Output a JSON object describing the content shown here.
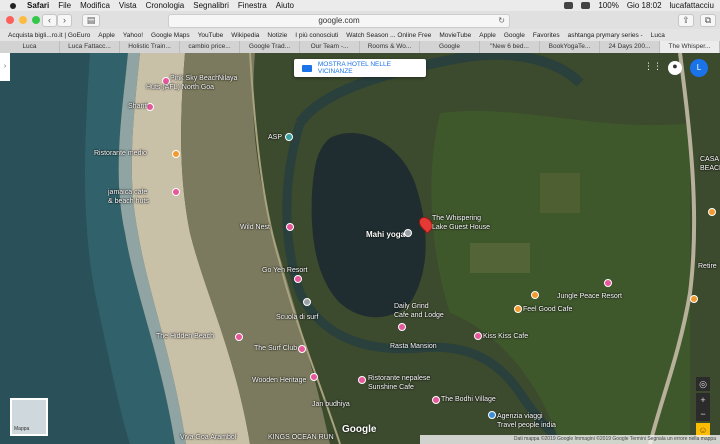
{
  "menubar": {
    "app": "Safari",
    "items": [
      "File",
      "Modifica",
      "Vista",
      "Cronologia",
      "Segnalibri",
      "Finestra",
      "Aiuto"
    ],
    "battery": "100%",
    "clock": "Gio 18:02",
    "user": "lucafattacciu"
  },
  "toolbar": {
    "url": "google.com"
  },
  "bookmarks": [
    "Acquista bigli...ro.it | GoEuro",
    "Apple",
    "Yahoo!",
    "Google Maps",
    "YouTube",
    "Wikipedia",
    "Notizie",
    "I più conosciuti",
    "Watch Season ... Online Free",
    "MovieTube",
    "Apple",
    "Google",
    "Favorites",
    "ashtanga prymary series -",
    "Luca"
  ],
  "tabs": [
    "Luca",
    "Luca Fattacc...",
    "Holistic Train...",
    "cambio price...",
    "Google Trad...",
    "Our Team -...",
    "Rooms & Wo...",
    "Google",
    "\"New 6 bed...",
    "BookYogaTe...",
    "24 Days 200...",
    "The Whisper..."
  ],
  "map": {
    "hotel_button": "MOSTRA HOTEL NELLE VICINANZE",
    "labels": {
      "l1": "Pink Sky Beach",
      "l2": "Huts (AFL) North Goa",
      "l3": "Shanti",
      "l4": "Nilaya",
      "l5": "ASP",
      "l6": "Ristorante medio",
      "l7": "jamaica cafe",
      "l8": "& beach huts",
      "l9": "Wild Nest",
      "l10": "Mahi yoga",
      "l11": "The Whispering",
      "l12": "Lake Guest House",
      "l13": "Scuola di surf",
      "l14": "The Hidden Beach",
      "l15": "The Surf Club",
      "l16": "Daily Grind",
      "l17": "Cafe and Lodge",
      "l18": "Rasta Mansion",
      "l19": "Kiss Kiss Cafe",
      "l20": "Feel Good Cafe",
      "l21": "Jungle Peace Resort",
      "l22": "Ristorante nepalese",
      "l23": "Sunshine Cafe",
      "l24": "The Bodhi Village",
      "l25": "Agenzia viaggi",
      "l26": "Travel people india",
      "l27": "Viva Goa Arambol",
      "l28": "KINGS OCEAN RUN",
      "l29": "Wooden Heritage",
      "l30": "Jan budhiya",
      "l31": "CASA",
      "l32": "BEACH",
      "l33": "Retire",
      "l34": "Go Yeh Resort"
    },
    "thumbnail_label": "Mappa",
    "logo": "Google",
    "attribution": "Dati mappa ©2019 Google  Immagini ©2019 Google  Termini  Segnala un errore nella mappa"
  }
}
